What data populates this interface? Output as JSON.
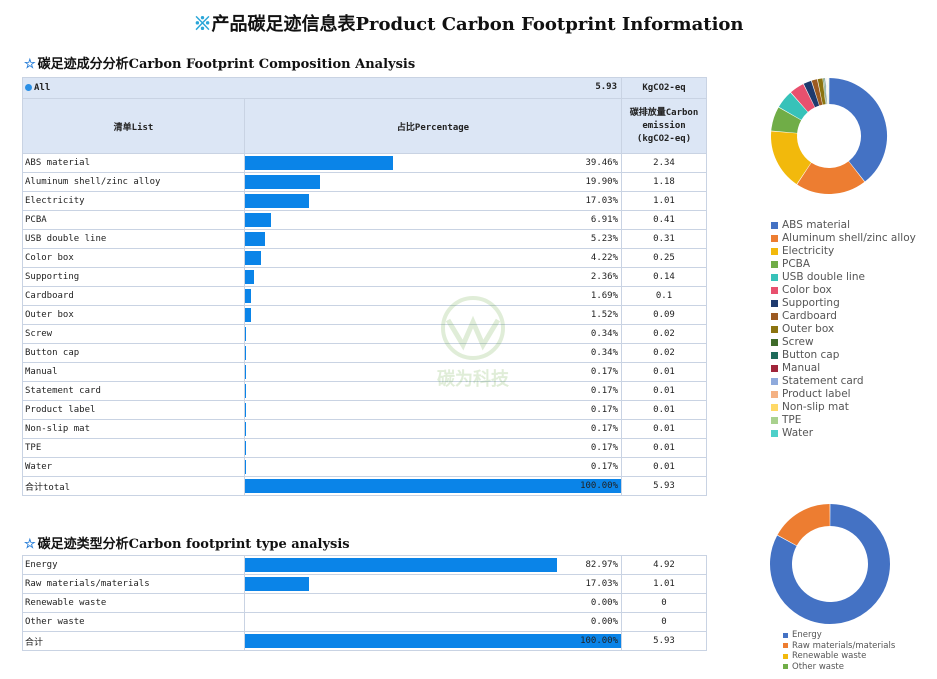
{
  "title": {
    "mark": "※",
    "text": "产品碳足迹信息表Product Carbon Footprint Information"
  },
  "section1": {
    "star": "☆",
    "title": "碳足迹成分分析Carbon Footprint Composition Analysis",
    "all_label": "All",
    "all_value": "5.93",
    "all_unit": "KgCO2-eq",
    "head_list": "清单List",
    "head_pct": "占比Percentage",
    "head_emission": "碳排放量Carbon emission (kgCO2-eq)",
    "total_label": "合计total",
    "total_pct": "100.00%",
    "total_value": "5.93"
  },
  "section2": {
    "star": "☆",
    "title": "碳足迹类型分析Carbon footprint type analysis",
    "total_label": "合计",
    "total_pct": "100.00%",
    "total_value": "5.93"
  },
  "watermark": {
    "text": "碳为科技"
  },
  "chart_data": [
    {
      "type": "table",
      "categories": [
        "ABS material",
        "Aluminum shell/zinc alloy",
        "Electricity",
        "PCBA",
        "USB double line",
        "Color box",
        "Supporting",
        "Cardboard",
        "Outer box",
        "Screw",
        "Button cap",
        "Manual",
        "Statement card",
        "Product label",
        "Non-slip mat",
        "TPE",
        "Water"
      ],
      "percent_labels": [
        "39.46%",
        "19.90%",
        "17.03%",
        "6.91%",
        "5.23%",
        "4.22%",
        "2.36%",
        "1.69%",
        "1.52%",
        "0.34%",
        "0.34%",
        "0.17%",
        "0.17%",
        "0.17%",
        "0.17%",
        "0.17%",
        "0.17%"
      ],
      "percent": [
        39.46,
        19.9,
        17.03,
        6.91,
        5.23,
        4.22,
        2.36,
        1.69,
        1.52,
        0.34,
        0.34,
        0.17,
        0.17,
        0.17,
        0.17,
        0.17,
        0.17
      ],
      "emission_labels": [
        "2.34",
        "1.18",
        "1.01",
        "0.41",
        "0.31",
        "0.25",
        "0.14",
        "0.1",
        "0.09",
        "0.02",
        "0.02",
        "0.01",
        "0.01",
        "0.01",
        "0.01",
        "0.01",
        "0.01"
      ]
    },
    {
      "type": "pie",
      "donut": true,
      "labels": [
        "ABS material",
        "Aluminum shell/zinc alloy",
        "Electricity",
        "PCBA",
        "USB double line",
        "Color box",
        "Supporting",
        "Cardboard",
        "Outer box",
        "Screw",
        "Button cap",
        "Manual",
        "Statement card",
        "Product label",
        "Non-slip mat",
        "TPE",
        "Water"
      ],
      "values": [
        39.46,
        19.9,
        17.03,
        6.91,
        5.23,
        4.22,
        2.36,
        1.69,
        1.52,
        0.34,
        0.34,
        0.17,
        0.17,
        0.17,
        0.17,
        0.17,
        0.17
      ],
      "colors": [
        "#4472c4",
        "#ed7d31",
        "#f2b90c",
        "#70ad47",
        "#37c2b9",
        "#e8506e",
        "#1f3a6e",
        "#9c5a22",
        "#8c7410",
        "#3f6b2a",
        "#1e6b5a",
        "#a0243a",
        "#8faadc",
        "#f4b183",
        "#ffd966",
        "#a9d18e",
        "#4dd0c9"
      ],
      "legend": "right"
    },
    {
      "type": "table",
      "categories": [
        "Energy",
        "Raw materials/materials",
        "Renewable waste",
        "Other waste"
      ],
      "percent_labels": [
        "82.97%",
        "17.03%",
        "0.00%",
        "0.00%"
      ],
      "percent": [
        82.97,
        17.03,
        0,
        0
      ],
      "emission_labels": [
        "4.92",
        "1.01",
        "0",
        "0"
      ]
    },
    {
      "type": "pie",
      "donut": true,
      "labels": [
        "Energy",
        "Raw materials/materials",
        "Renewable waste",
        "Other waste"
      ],
      "values": [
        82.97,
        17.03,
        0,
        0
      ],
      "colors": [
        "#4472c4",
        "#ed7d31",
        "#f2b90c",
        "#70ad47"
      ],
      "legend": "bottom"
    }
  ]
}
